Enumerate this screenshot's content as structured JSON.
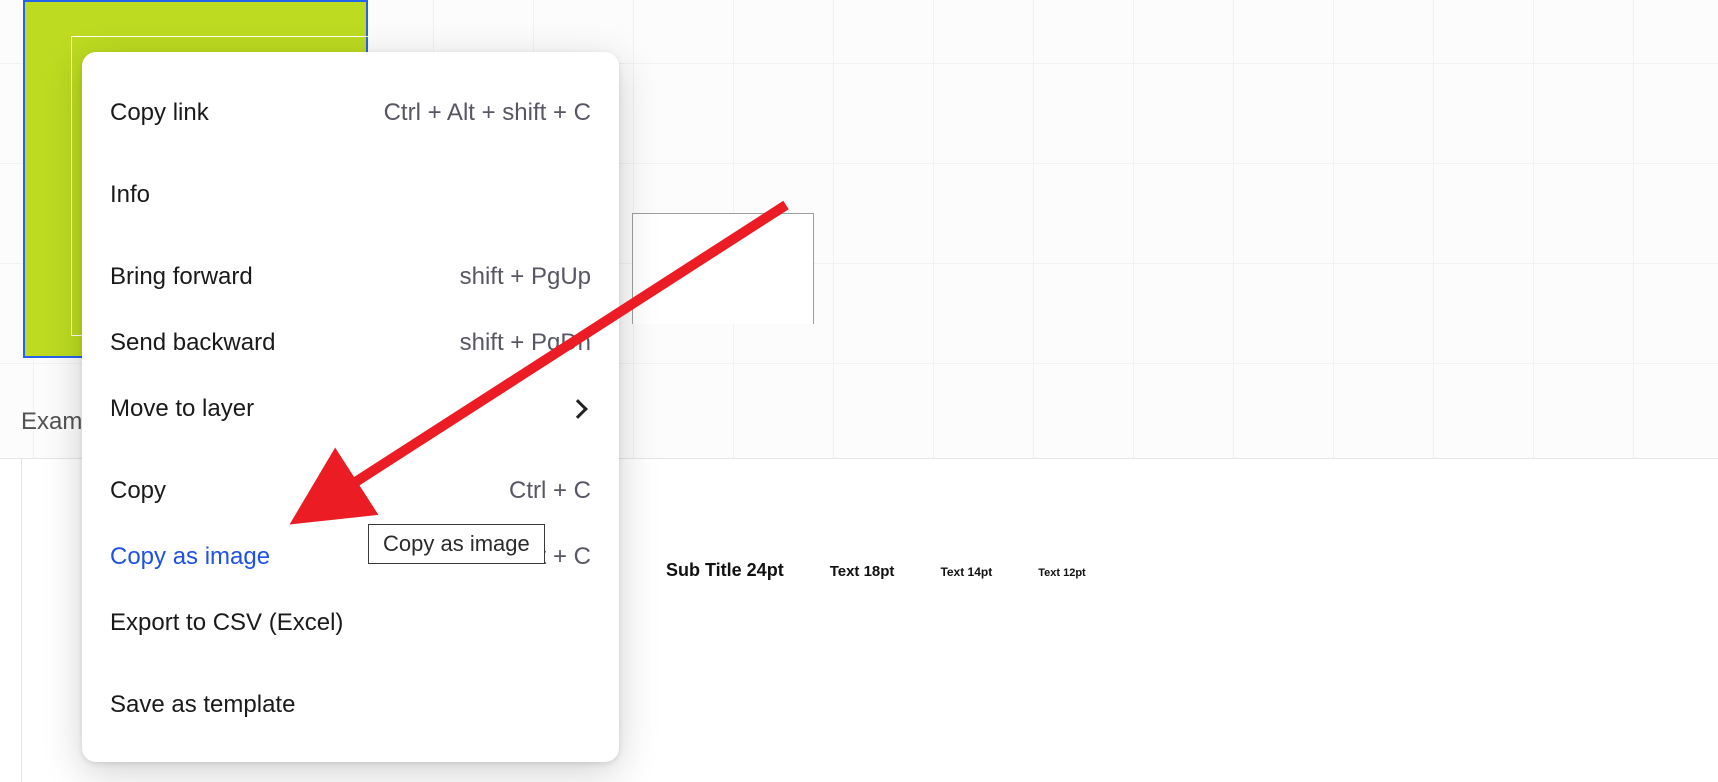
{
  "canvas": {
    "partial_label": "Exam"
  },
  "context_menu": {
    "items": [
      {
        "label": "Copy link",
        "shortcut": "Ctrl + Alt + shift + C",
        "submenu": false,
        "highlight": false,
        "gap_after": true
      },
      {
        "label": "Info",
        "shortcut": "",
        "submenu": false,
        "highlight": false,
        "gap_after": true
      },
      {
        "label": "Bring forward",
        "shortcut": "shift + PgUp",
        "submenu": false,
        "highlight": false,
        "gap_after": false
      },
      {
        "label": "Send backward",
        "shortcut": "shift + PgDn",
        "submenu": false,
        "highlight": false,
        "gap_after": false
      },
      {
        "label": "Move to layer",
        "shortcut": "",
        "submenu": true,
        "highlight": false,
        "gap_after": true
      },
      {
        "label": "Copy",
        "shortcut": "Ctrl + C",
        "submenu": false,
        "highlight": false,
        "gap_after": false
      },
      {
        "label": "Copy as image",
        "shortcut": "Ctrl + shift + C",
        "submenu": false,
        "highlight": true,
        "gap_after": false
      },
      {
        "label": "Export to CSV (Excel)",
        "shortcut": "",
        "submenu": false,
        "highlight": false,
        "gap_after": true
      },
      {
        "label": "Save as template",
        "shortcut": "",
        "submenu": false,
        "highlight": false,
        "gap_after": false
      }
    ]
  },
  "tooltip": {
    "text": "Copy as image"
  },
  "text_samples": {
    "sub_title": "Sub Title 24pt",
    "t18": "Text 18pt",
    "t14": "Text 14pt",
    "t12": "Text 12pt"
  },
  "annotation": {
    "color": "#eb1c24"
  }
}
